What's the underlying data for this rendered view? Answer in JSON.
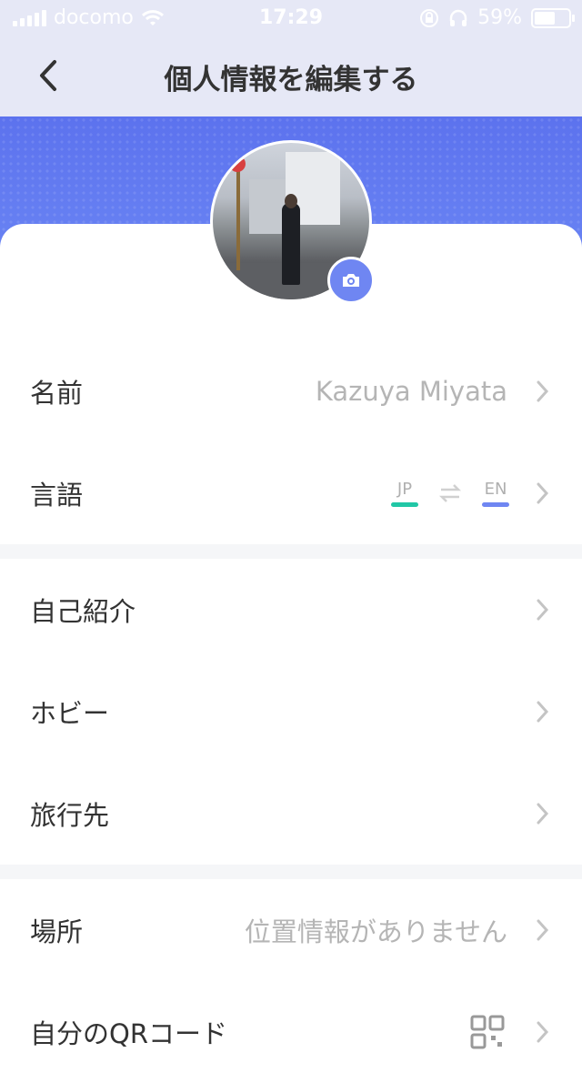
{
  "status_bar": {
    "carrier": "docomo",
    "time": "17:29",
    "battery": "59%"
  },
  "nav": {
    "title": "個人情報を編集する"
  },
  "rows": [
    {
      "label": "名前",
      "value": "Kazuya Miyata"
    },
    {
      "label": "言語"
    },
    {
      "label": "自己紹介"
    },
    {
      "label": "ホビー"
    },
    {
      "label": "旅行先"
    },
    {
      "label": "場所",
      "value": "位置情報がありません"
    },
    {
      "label": "自分のQRコード"
    }
  ],
  "language": {
    "from": "JP",
    "to": "EN",
    "from_color": "#21c7a6",
    "to_color": "#6f86f2"
  },
  "colors": {
    "accent": "#6f86f2",
    "banner": "#5c72ee",
    "nav_bg": "#e6e8f6"
  }
}
